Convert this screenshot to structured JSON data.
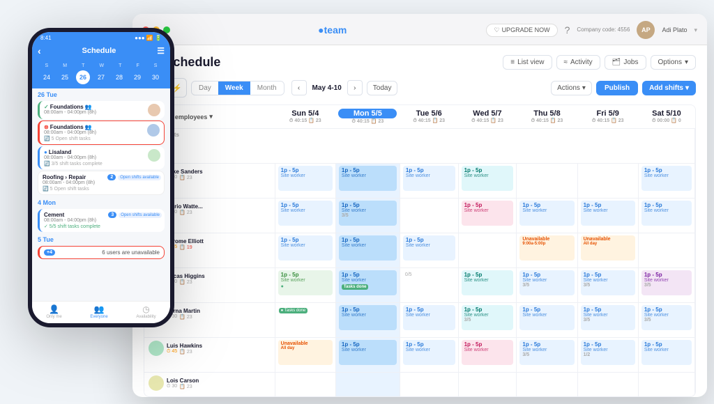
{
  "app": {
    "name": "team",
    "upgrade_label": "UPGRADE NOW",
    "company_label": "Company code: 4556",
    "user_name": "Adi Plato"
  },
  "page": {
    "title": "Schedule",
    "icon": "📅"
  },
  "header_buttons": {
    "list_view": "List view",
    "activity": "Activity",
    "jobs": "Jobs",
    "options": "Options"
  },
  "toolbar": {
    "views": [
      "Day",
      "Week",
      "Month"
    ],
    "active_view": "Week",
    "date_range": "May 4-10",
    "today": "Today",
    "actions": "Actions",
    "publish": "Publish",
    "add_shifts": "Add shifts"
  },
  "schedule": {
    "view_by": "View by employees",
    "columns": [
      {
        "day": "Sun 5/4",
        "hours": "40:15",
        "count": 23
      },
      {
        "day": "Mon 5/5",
        "hours": "40:15",
        "count": 23,
        "today": true
      },
      {
        "day": "Tue 5/6",
        "hours": "40:15",
        "count": 23
      },
      {
        "day": "Wed 5/7",
        "hours": "40:15",
        "count": 23
      },
      {
        "day": "Thu 5/8",
        "hours": "40:15",
        "count": 23
      },
      {
        "day": "Fri 5/9",
        "hours": "40:15",
        "count": 23
      },
      {
        "day": "Sat 5/10",
        "hours": "00:00",
        "count": 0
      }
    ],
    "open_shifts_label": "Open shifts",
    "employees": [
      {
        "name": "Mike Sanders",
        "stats": "⏱ 30  📋 23",
        "avatar_class": "emp-1",
        "shifts": [
          {
            "col": 0,
            "label": "1p - 5p",
            "sub": "Site worker",
            "style": "shift-blue"
          },
          {
            "col": 1,
            "label": "1p - 5p",
            "sub": "Site worker",
            "style": "shift-today"
          },
          {
            "col": 2,
            "label": "1p - 5p",
            "sub": "Site worker",
            "style": "shift-blue"
          },
          {
            "col": 3,
            "label": "1p - 5p",
            "sub": "Site worker",
            "style": "shift-teal"
          },
          {
            "col": 4,
            "label": "",
            "sub": "",
            "style": ""
          },
          {
            "col": 5,
            "label": "",
            "sub": "",
            "style": ""
          },
          {
            "col": 6,
            "label": "1p - 5p",
            "sub": "Site worker",
            "style": "shift-blue"
          }
        ]
      },
      {
        "name": "Mario Watte...",
        "stats": "⏱ 30  📋 23",
        "avatar_class": "emp-2",
        "shifts": [
          {
            "col": 0,
            "label": "1p - 5p",
            "sub": "Site worker",
            "style": "shift-blue"
          },
          {
            "col": 1,
            "label": "1p - 5p",
            "sub": "Site worker",
            "style": "shift-today",
            "badge": "3/5"
          },
          {
            "col": 2,
            "label": "",
            "sub": "",
            "style": ""
          },
          {
            "col": 3,
            "label": "1p - 5p",
            "sub": "Site worker",
            "style": "shift-pink"
          },
          {
            "col": 4,
            "label": "1p - 5p",
            "sub": "Site worker",
            "style": "shift-blue"
          },
          {
            "col": 5,
            "label": "1p - 5p",
            "sub": "Site worker",
            "style": "shift-blue"
          },
          {
            "col": 6,
            "label": "1p - 5p",
            "sub": "Site worker",
            "style": "shift-blue"
          }
        ]
      },
      {
        "name": "Jerome Elliott",
        "stats_orange": "⏱ 45",
        "stats_red": "📋 19",
        "avatar_class": "emp-3",
        "shifts": [
          {
            "col": 0,
            "label": "1p - 5p",
            "sub": "Site worker",
            "style": "shift-blue"
          },
          {
            "col": 1,
            "label": "1p - 5p",
            "sub": "Site worker",
            "style": "shift-today"
          },
          {
            "col": 2,
            "label": "1p - 5p",
            "sub": "Site worker",
            "style": "shift-blue"
          },
          {
            "col": 3,
            "label": "",
            "sub": "",
            "style": ""
          },
          {
            "col": 4,
            "label": "Unavailable",
            "sub": "9:00a-5:00p",
            "style": "shift-unavail"
          },
          {
            "col": 5,
            "label": "Unavailable",
            "sub": "All day",
            "style": "shift-unavail"
          },
          {
            "col": 6,
            "label": "",
            "sub": "",
            "style": ""
          }
        ]
      },
      {
        "name": "Lucas Higgins",
        "stats": "⏱ 30  📋 23",
        "avatar_class": "emp-4",
        "shifts": [
          {
            "col": 0,
            "label": "1p - 5p",
            "sub": "Site worker",
            "style": "shift-blue",
            "badge_green": "●"
          },
          {
            "col": 1,
            "label": "1p - 5p",
            "sub": "Site worker",
            "style": "shift-today",
            "badge": "Tasks done"
          },
          {
            "col": 2,
            "label": "",
            "sub": "",
            "style": "",
            "badge": "0/5"
          },
          {
            "col": 3,
            "label": "1p - 5p",
            "sub": "Site worker",
            "style": "shift-teal"
          },
          {
            "col": 4,
            "label": "1p - 5p",
            "sub": "Site worker",
            "style": "shift-blue",
            "badge": "3/5"
          },
          {
            "col": 5,
            "label": "1p - 5p",
            "sub": "Site worker",
            "style": "shift-blue",
            "badge": "3/5"
          },
          {
            "col": 6,
            "label": "1p - 5p",
            "sub": "Site worker",
            "style": "shift-blue",
            "badge": "3/5"
          }
        ]
      },
      {
        "name": "Verna Martin",
        "stats": "⏱ 30  📋 23",
        "avatar_class": "emp-5",
        "shifts": [
          {
            "col": 0,
            "label": "",
            "sub": "",
            "style": "",
            "badge_green": "● Tasks done"
          },
          {
            "col": 1,
            "label": "1p - 5p",
            "sub": "Site worker",
            "style": "shift-today"
          },
          {
            "col": 2,
            "label": "1p - 5p",
            "sub": "Site worker",
            "style": "shift-blue"
          },
          {
            "col": 3,
            "label": "1p - 5p",
            "sub": "Site worker",
            "style": "shift-teal",
            "badge": "3/5"
          },
          {
            "col": 4,
            "label": "1p - 5p",
            "sub": "Site worker",
            "style": "shift-blue"
          },
          {
            "col": 5,
            "label": "1p - 5p",
            "sub": "Site worker",
            "style": "shift-blue",
            "badge": "3/5"
          },
          {
            "col": 6,
            "label": "1p - 5p",
            "sub": "Site worker",
            "style": "shift-blue",
            "badge": "3/5"
          }
        ]
      },
      {
        "name": "Luis Hawkins",
        "stats_orange": "⏱ 45",
        "stats_red": "📋 23",
        "avatar_class": "emp-6",
        "shifts": [
          {
            "col": 0,
            "label": "Unavailable",
            "sub": "All day",
            "style": "shift-unavail"
          },
          {
            "col": 1,
            "label": "1p - 5p",
            "sub": "Site worker",
            "style": "shift-today"
          },
          {
            "col": 2,
            "label": "1p - 5p",
            "sub": "Site worker",
            "style": "shift-blue"
          },
          {
            "col": 3,
            "label": "1p - 5p",
            "sub": "Site worker",
            "style": "shift-pink"
          },
          {
            "col": 4,
            "label": "1p - 5p",
            "sub": "Site worker",
            "style": "shift-blue",
            "badge": "3/5"
          },
          {
            "col": 5,
            "label": "1p - 5p",
            "sub": "Site worker",
            "style": "shift-blue",
            "badge": "1/2"
          },
          {
            "col": 6,
            "label": "1p - 5p",
            "sub": "Site worker",
            "style": "shift-blue"
          }
        ]
      },
      {
        "name": "Lois Carson",
        "stats": "⏱ 30  📋 23",
        "avatar_class": "emp-7",
        "shifts": [
          {
            "col": 0,
            "label": "",
            "sub": "",
            "style": ""
          },
          {
            "col": 1,
            "label": "",
            "sub": "",
            "style": ""
          },
          {
            "col": 2,
            "label": "",
            "sub": "",
            "style": ""
          },
          {
            "col": 3,
            "label": "",
            "sub": "",
            "style": ""
          },
          {
            "col": 4,
            "label": "",
            "sub": "",
            "style": ""
          },
          {
            "col": 5,
            "label": "",
            "sub": "",
            "style": ""
          },
          {
            "col": 6,
            "label": "",
            "sub": "",
            "style": ""
          }
        ]
      }
    ]
  },
  "phone": {
    "time": "8:41",
    "header_title": "Schedule",
    "cal_days": [
      "S",
      "M",
      "T",
      "W",
      "T",
      "F",
      "S"
    ],
    "cal_dates": [
      "24",
      "25",
      "26",
      "27",
      "28",
      "29",
      "30"
    ],
    "today_date": "26",
    "sections": [
      {
        "day_label": "26 Tue",
        "shifts": [
          {
            "title": "Foundations",
            "icons": "👥",
            "time": "08:00am - 04:00pm (8h)",
            "color": "green",
            "has_avatar": true
          },
          {
            "title": "Foundations",
            "icons": "⊗",
            "time": "08:00am - 04:00pm (8h)",
            "color": "red-outline",
            "has_avatar": true,
            "sub": "5 Open shift tasks"
          },
          {
            "title": "Lisaland",
            "time": "08:00am - 04:00pm (8h)",
            "color": "blue",
            "has_avatar": true,
            "sub": "3/5 shift tasks complete"
          },
          {
            "title": "Roofing > Repair",
            "time": "08:00am - 04:00pm (8h)",
            "color": "roofing",
            "badge": "2",
            "open": "Open shifts available",
            "sub": "5 Open shift tasks"
          }
        ]
      },
      {
        "day_label": "4 Mon",
        "shifts": [
          {
            "title": "Cement",
            "time": "08:00am - 04:00pm (8h)",
            "color": "blue",
            "badge": "3",
            "open": "Open shifts available",
            "sub": "5/5 shift tasks complete"
          }
        ]
      },
      {
        "day_label": "5 Tue",
        "shifts": [
          {
            "title": "+4",
            "time": "6 users are unavailable",
            "color": "red-outline"
          }
        ]
      }
    ],
    "nav_items": [
      {
        "label": "Only me",
        "icon": "👤",
        "active": false
      },
      {
        "label": "Everyone",
        "icon": "👥",
        "active": true
      },
      {
        "label": "Availability",
        "icon": "◷",
        "active": false
      }
    ]
  }
}
